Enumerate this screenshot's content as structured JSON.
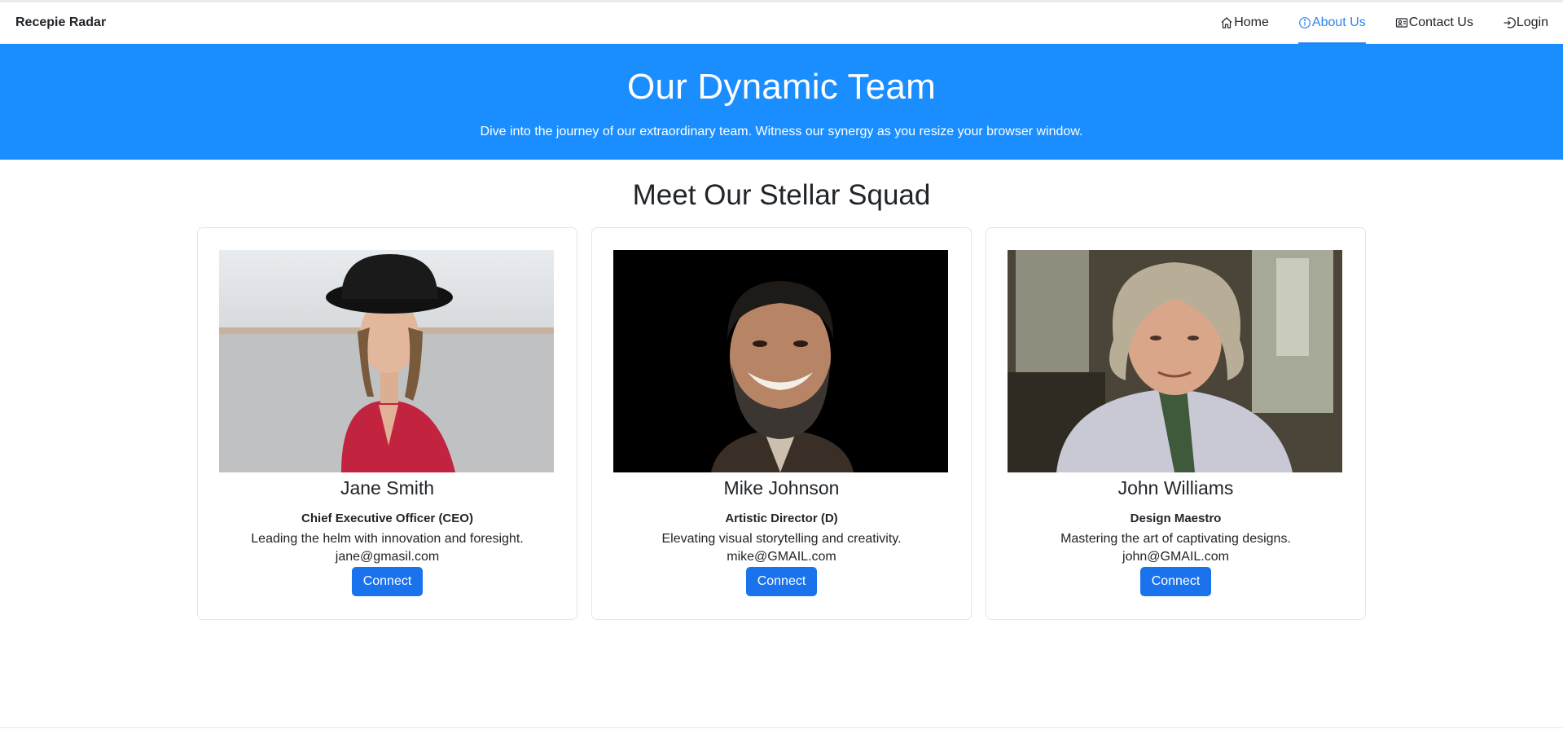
{
  "navbar": {
    "brand": "Recepie Radar",
    "items": [
      {
        "label": "Home",
        "icon": "home-icon"
      },
      {
        "label": "About Us",
        "icon": "info-icon",
        "active": true
      },
      {
        "label": "Contact Us",
        "icon": "contact-card-icon"
      },
      {
        "label": "Login",
        "icon": "login-icon"
      }
    ]
  },
  "hero": {
    "title": "Our Dynamic Team",
    "subtitle": "Dive into the journey of our extraordinary team. Witness our synergy as you resize your browser window."
  },
  "section": {
    "title": "Meet Our Stellar Squad"
  },
  "team": [
    {
      "name": "Jane Smith",
      "role": "Chief Executive Officer (CEO)",
      "description": "Leading the helm with innovation and foresight.",
      "email": "jane@gmasil.com",
      "button": "Connect"
    },
    {
      "name": "Mike Johnson",
      "role": "Artistic Director (D)",
      "description": "Elevating visual storytelling and creativity.",
      "email": "mike@GMAIL.com",
      "button": "Connect"
    },
    {
      "name": "John Williams",
      "role": "Design Maestro",
      "description": "Mastering the art of captivating designs.",
      "email": "john@GMAIL.com",
      "button": "Connect"
    }
  ],
  "colors": {
    "hero_bg": "#1b8eff",
    "accent": "#2d83ee",
    "button": "#1a73ec"
  }
}
